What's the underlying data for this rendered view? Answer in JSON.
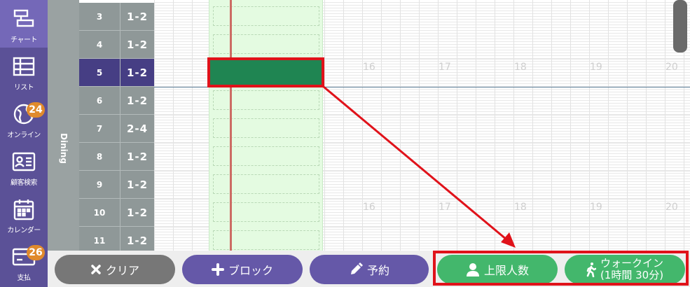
{
  "sidebar": {
    "items": [
      {
        "label": "チャート",
        "icon": "chart-icon",
        "active": true
      },
      {
        "label": "リスト",
        "icon": "list-icon"
      },
      {
        "label": "オンライン",
        "icon": "globe-icon",
        "badge": "24"
      },
      {
        "label": "顧客検索",
        "icon": "customer-card-icon"
      },
      {
        "label": "カレンダー",
        "icon": "calendar-icon"
      },
      {
        "label": "支払",
        "icon": "payment-card-icon",
        "badge": "26"
      }
    ]
  },
  "area": {
    "label": "Dining"
  },
  "tables": [
    {
      "num": "3",
      "cap_min": "1",
      "cap_max": "2"
    },
    {
      "num": "4",
      "cap_min": "1",
      "cap_max": "2"
    },
    {
      "num": "5",
      "cap_min": "1",
      "cap_max": "2",
      "selected": true
    },
    {
      "num": "6",
      "cap_min": "1",
      "cap_max": "2"
    },
    {
      "num": "7",
      "cap_min": "2",
      "cap_max": "4"
    },
    {
      "num": "8",
      "cap_min": "1",
      "cap_max": "2"
    },
    {
      "num": "9",
      "cap_min": "1",
      "cap_max": "2"
    },
    {
      "num": "10",
      "cap_min": "1",
      "cap_max": "2"
    },
    {
      "num": "11",
      "cap_min": "1",
      "cap_max": "2"
    }
  ],
  "hours_row1": [
    "16",
    "17",
    "18",
    "19",
    "20"
  ],
  "hours_row2": [
    "16",
    "17",
    "18",
    "19",
    "20"
  ],
  "buttons": {
    "clear": "クリア",
    "block": "ブロック",
    "reserve": "予約",
    "limit": "上限人数",
    "walkin_line1": "ウォークイン",
    "walkin_line2": "(1時間 30分)"
  },
  "colors": {
    "sidebar": "#5b5197",
    "reservation": "#1f8552",
    "highlight": "#e0121a",
    "green_button": "#43b76c",
    "purple_button": "#6558a8"
  }
}
